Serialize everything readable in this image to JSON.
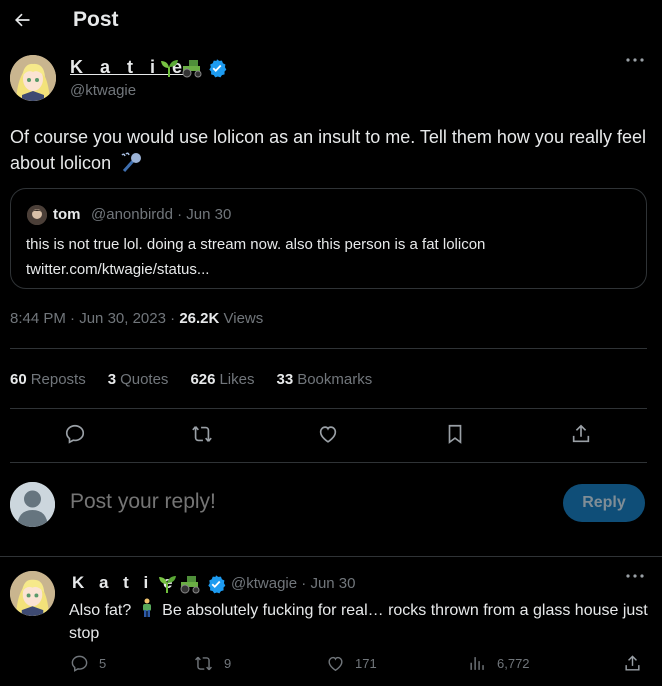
{
  "header": {
    "title": "Post",
    "back_icon": "arrow-left-icon"
  },
  "tweet": {
    "author_name": "K a t i e",
    "author_emojis": [
      "seedling-icon",
      "tractor-icon"
    ],
    "handle": "@ktwagie",
    "text": "Of course you would use lolicon as an insult to me. Tell them how you really feel about lolicon",
    "text_emoji": "microphone-icon",
    "quote": {
      "name": "tom",
      "handle": "@anonbirdd",
      "date": "Jun 30",
      "text_line1": "this is not true lol. doing a stream now. also this person is a fat lolicon",
      "text_line2": "twitter.com/ktwagie/status..."
    },
    "time": "8:44 PM",
    "date": "Jun 30, 2023",
    "views_count": "26.2K",
    "views_label": "Views",
    "stats": [
      {
        "num": "60",
        "label": "Reposts"
      },
      {
        "num": "3",
        "label": "Quotes"
      },
      {
        "num": "626",
        "label": "Likes"
      },
      {
        "num": "33",
        "label": "Bookmarks"
      }
    ]
  },
  "composer": {
    "placeholder": "Post your reply!",
    "button": "Reply"
  },
  "reply": {
    "author_name": "K a t i e",
    "handle": "@ktwagie",
    "date": "Jun 30",
    "text_before": "Also fat?",
    "text_after": "Be absolutely fucking for real… rocks thrown from a glass house just stop",
    "counts": {
      "replies": "5",
      "reposts": "9",
      "likes": "171",
      "views": "6,772"
    }
  },
  "colors": {
    "background": "#000000",
    "text": "#e7e9ea",
    "muted": "#71767b",
    "verified": "#1d9bf0",
    "divider": "#2f3336",
    "reply_button": "#0f4e78"
  }
}
